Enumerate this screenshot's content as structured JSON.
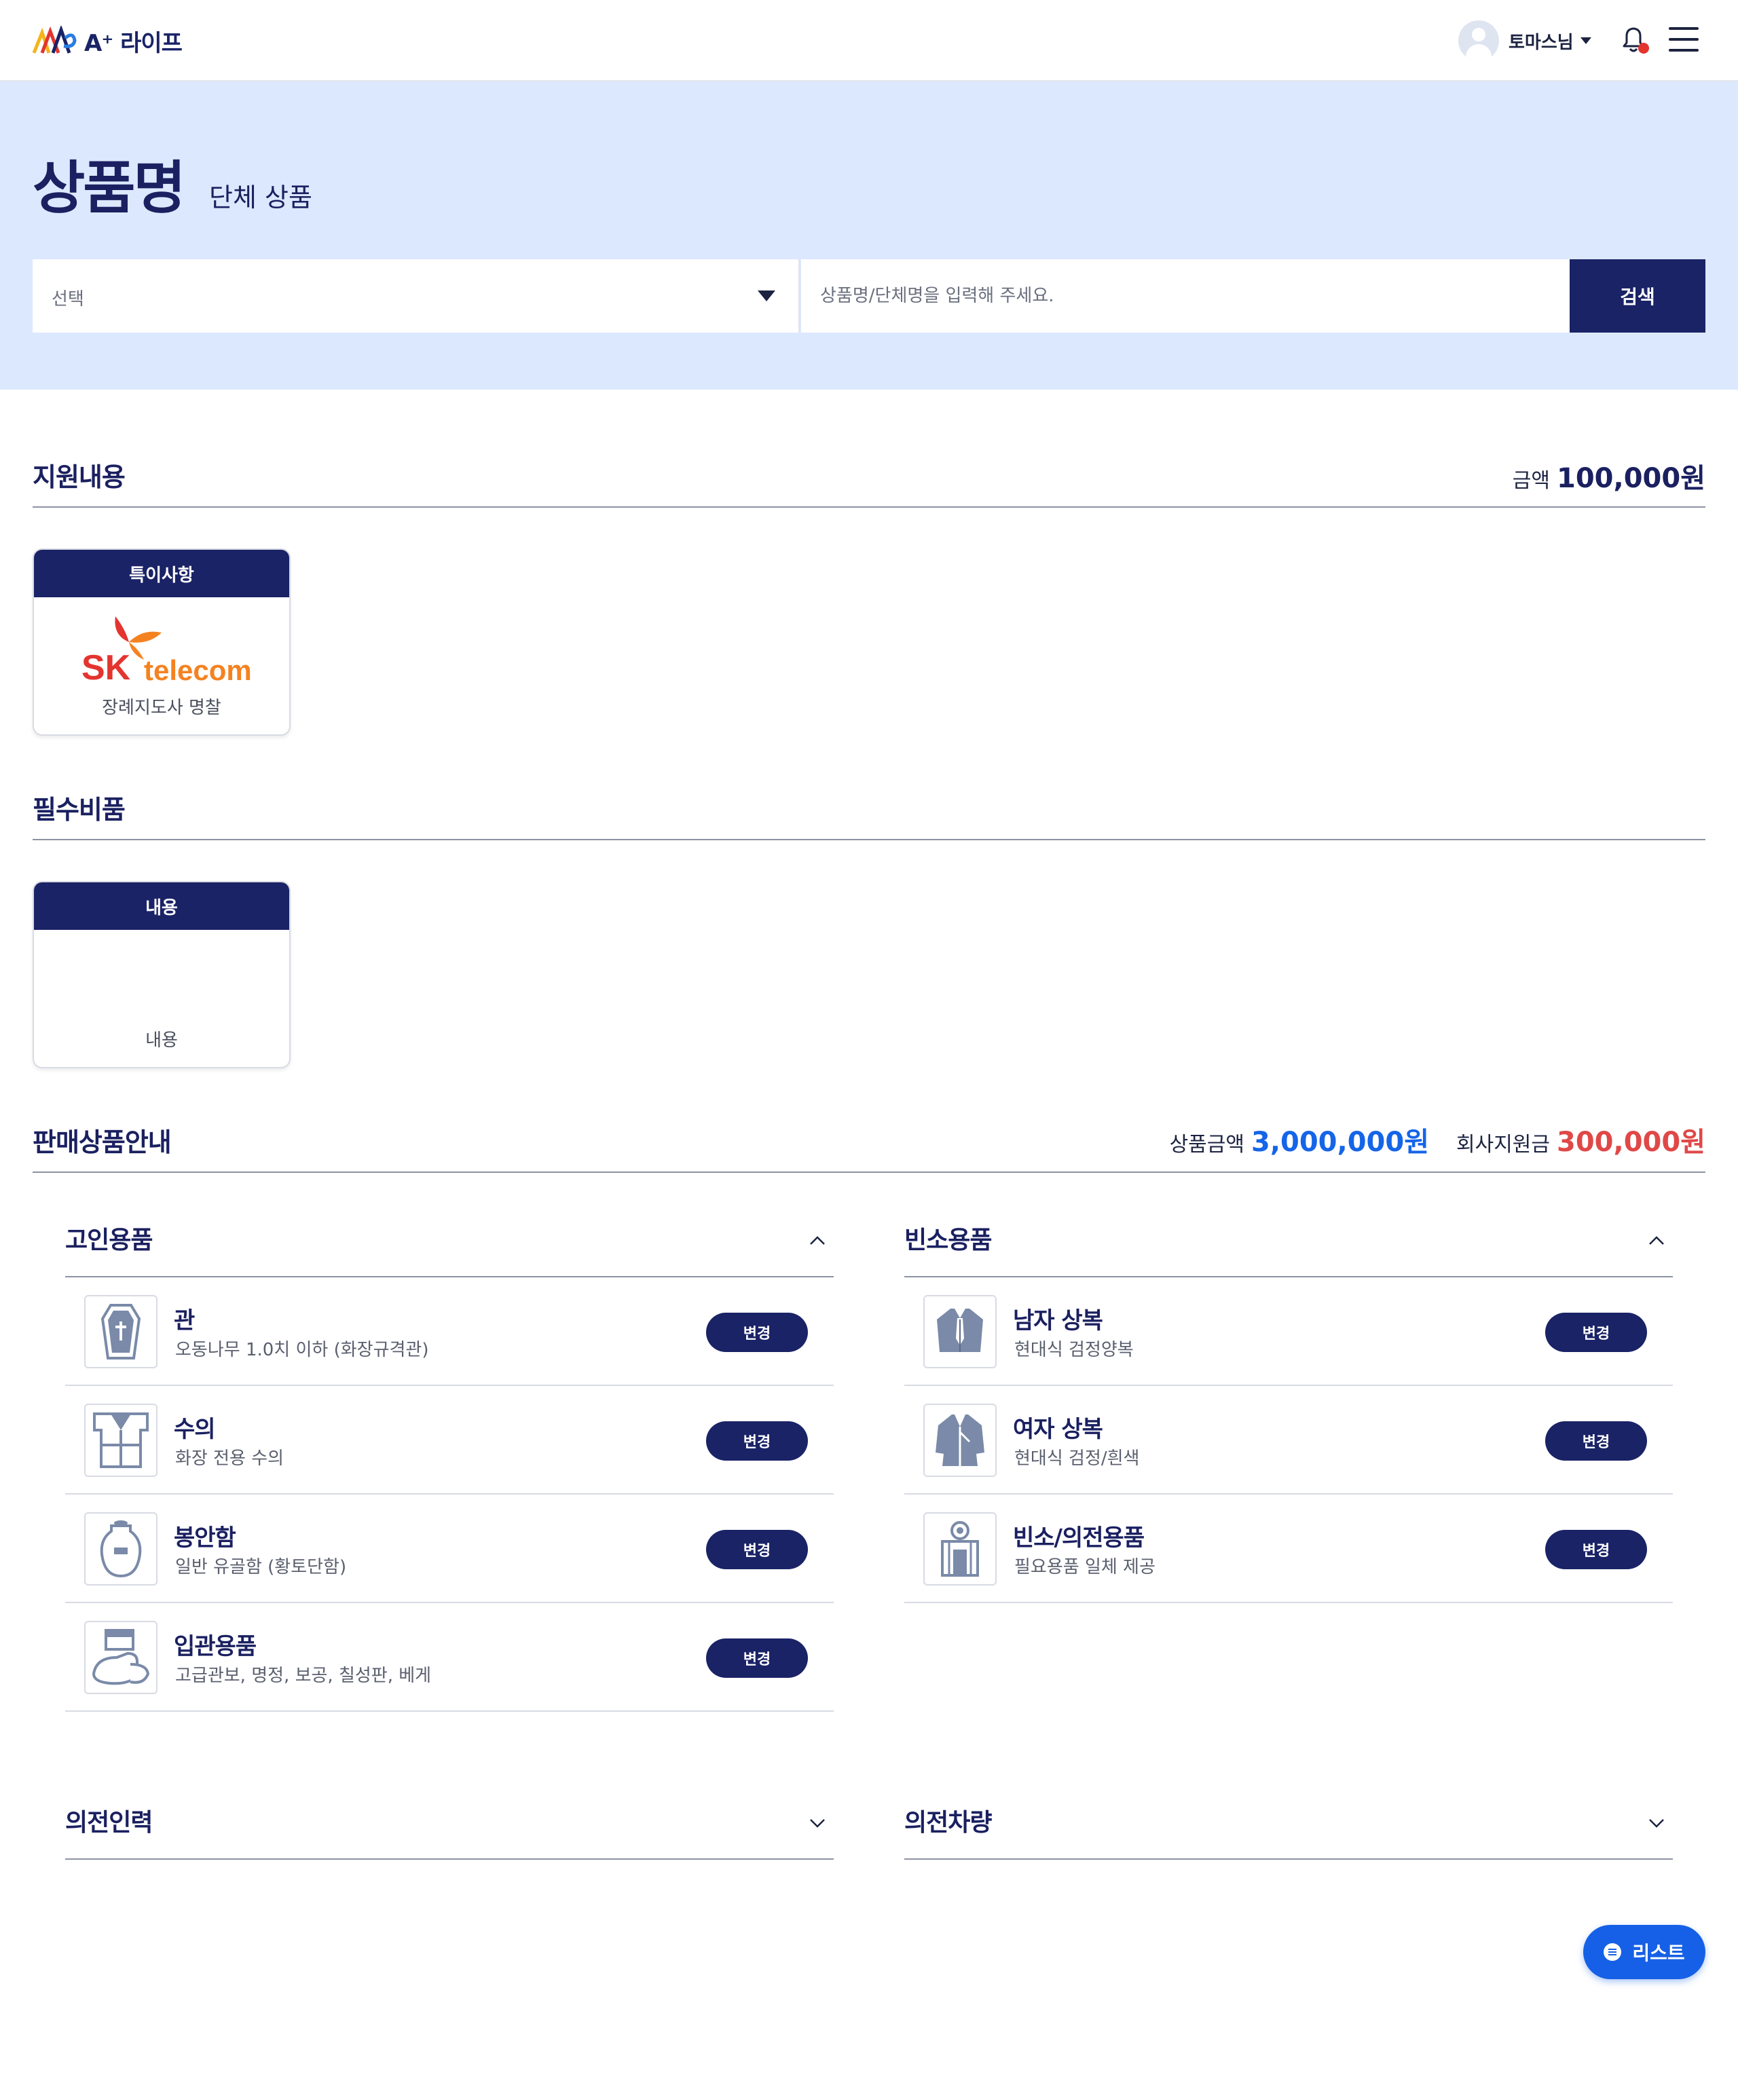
{
  "header": {
    "logo_text": "A⁺ 라이프",
    "user_name": "토마스님"
  },
  "hero": {
    "title": "상품명",
    "subtitle": "단체 상품",
    "select_value": "선택",
    "search_placeholder": "상품명/단체명을 입력해 주세요.",
    "search_button": "검색"
  },
  "support": {
    "title": "지원내용",
    "amount_label": "금액",
    "amount_value": "100,000원",
    "card": {
      "header": "특이사항",
      "logo_sk": "SK",
      "logo_telecom": "telecom",
      "caption": "장례지도사 명찰"
    }
  },
  "essentials": {
    "title": "필수비품",
    "card": {
      "header": "내용",
      "caption": "내용"
    }
  },
  "sales": {
    "title": "판매상품안내",
    "product_amount_label": "상품금액",
    "product_amount_value": "3,000,000원",
    "company_support_label": "회사지원금",
    "company_support_value": "300,000원"
  },
  "deceased_items": {
    "title": "고인용품",
    "items": [
      {
        "name": "관",
        "desc": "오동나무 1.0치 이하  (화장규격관)",
        "button": "변경",
        "icon": "coffin-icon"
      },
      {
        "name": "수의",
        "desc": "화장 전용 수의",
        "button": "변경",
        "icon": "shroud-icon"
      },
      {
        "name": "봉안함",
        "desc": "일반 유골함 (황토단함)",
        "button": "변경",
        "icon": "urn-icon"
      },
      {
        "name": "입관용품",
        "desc": "고급관보, 명정, 보공, 칠성판, 베게",
        "button": "변경",
        "icon": "casket-supplies-icon"
      }
    ]
  },
  "mourning_items": {
    "title": "빈소용품",
    "items": [
      {
        "name": "남자 상복",
        "desc": "현대식 검정양복",
        "button": "변경",
        "icon": "mens-suit-icon"
      },
      {
        "name": "여자 상복",
        "desc": "현대식 검정/흰색",
        "button": "변경",
        "icon": "womens-hanbok-icon"
      },
      {
        "name": "빈소/의전용품",
        "desc": "필요용품 일체 제공",
        "button": "변경",
        "icon": "altar-icon"
      }
    ]
  },
  "ceremony_staff": {
    "title": "의전인력"
  },
  "ceremony_vehicle": {
    "title": "의전차량"
  },
  "fab": {
    "label": "리스트"
  }
}
